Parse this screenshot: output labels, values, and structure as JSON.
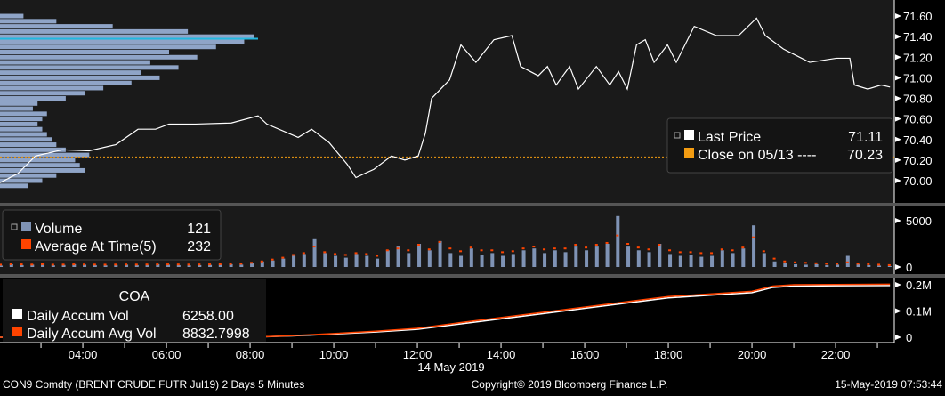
{
  "colors": {
    "price": "#ffffff",
    "close": "#f39c12",
    "volume": "#7f93b5",
    "avg": "#ff4400",
    "accum": "#ffffff",
    "accum_avg": "#ff4400",
    "profile": "#8fa4c7",
    "profile_hi": "#22b8e0"
  },
  "footer": {
    "left": "CON9 Comdty (BRENT CRUDE FUTR  Jul19) 2 Days 5 Minutes",
    "center": "Copyright© 2019 Bloomberg Finance L.P.",
    "right": "15-May-2019 07:53:44"
  },
  "price_legend": {
    "last_label": "Last Price",
    "last_value": "71.11",
    "close_label": "Close on 05/13 ----",
    "close_value": "70.23"
  },
  "volume_legend": {
    "vol_label": "Volume",
    "vol_value": "121",
    "avg_label": "Average At Time(5)",
    "avg_value": "232"
  },
  "accum_legend": {
    "title": "COA",
    "vol_label": "Daily Accum Vol",
    "vol_value": "6258.00",
    "avg_label": "Daily Accum Avg Vol",
    "avg_value": "8832.7998"
  },
  "chart_data": [
    {
      "type": "line",
      "title": "Last Price",
      "ylim": [
        69.87,
        71.75
      ],
      "yticks": [
        "71.60",
        "71.40",
        "71.20",
        "71.00",
        "70.80",
        "70.60",
        "70.40",
        "70.20",
        "70.00"
      ],
      "close_level": 70.23,
      "profile_peak": 71.38,
      "x": [
        2.02,
        2.45,
        2.87,
        3.51,
        4.15,
        4.79,
        5.32,
        5.74,
        6.06,
        6.7,
        7.55,
        8.19,
        8.4,
        9.15,
        9.47,
        9.89,
        10.32,
        10.53,
        10.74,
        10.96,
        11.38,
        11.7,
        12.02,
        12.19,
        12.34,
        12.77,
        13.04,
        13.4,
        13.83,
        14.26,
        14.47,
        14.89,
        15.11,
        15.32,
        15.64,
        15.85,
        16.28,
        16.6,
        16.81,
        17.02,
        17.24,
        17.45,
        17.66,
        17.98,
        18.19,
        18.62,
        19.15,
        19.68,
        20.11,
        20.32,
        20.75,
        21.38,
        22.02,
        22.34,
        22.45,
        22.77,
        23.09,
        23.3
      ],
      "y": [
        69.98,
        70.07,
        70.24,
        70.3,
        70.29,
        70.35,
        70.5,
        70.5,
        70.55,
        70.55,
        70.56,
        70.63,
        70.55,
        70.42,
        70.5,
        70.37,
        70.16,
        70.03,
        70.07,
        70.11,
        70.24,
        70.2,
        70.24,
        70.46,
        70.8,
        70.98,
        71.32,
        71.15,
        71.37,
        71.41,
        71.11,
        71.02,
        71.11,
        70.93,
        71.11,
        70.89,
        71.11,
        70.93,
        71.06,
        70.89,
        71.32,
        71.37,
        71.15,
        71.32,
        71.15,
        71.5,
        71.41,
        71.41,
        71.58,
        71.41,
        71.28,
        71.15,
        71.19,
        71.19,
        70.93,
        70.89,
        70.93,
        70.91
      ],
      "profile_levels": [
        69.95,
        70.0,
        70.05,
        70.1,
        70.15,
        70.2,
        70.25,
        70.3,
        70.35,
        70.4,
        70.45,
        70.5,
        70.55,
        70.6,
        70.65,
        70.7,
        70.75,
        70.8,
        70.85,
        70.9,
        70.95,
        71.0,
        71.05,
        71.1,
        71.15,
        71.2,
        71.25,
        71.3,
        71.35,
        71.4,
        71.45,
        71.5,
        71.55,
        71.6
      ],
      "profile_values": [
        30,
        45,
        60,
        90,
        85,
        80,
        95,
        70,
        60,
        55,
        50,
        45,
        40,
        45,
        50,
        35,
        40,
        70,
        90,
        110,
        140,
        170,
        150,
        190,
        160,
        210,
        180,
        230,
        260,
        270,
        200,
        120,
        60,
        25
      ]
    },
    {
      "type": "bar",
      "title": "Volume",
      "ylim": [
        0,
        6000
      ],
      "yticks": [
        "5000",
        "0"
      ],
      "start": 2.0,
      "step_hours": 0.25,
      "values": [
        150,
        300,
        200,
        250,
        400,
        180,
        220,
        300,
        250,
        200,
        180,
        220,
        250,
        200,
        220,
        300,
        250,
        200,
        180,
        200,
        220,
        250,
        300,
        250,
        400,
        600,
        700,
        900,
        1200,
        1400,
        3000,
        1500,
        1200,
        1000,
        1400,
        1200,
        900,
        1800,
        2200,
        1500,
        2500,
        1800,
        2800,
        1500,
        1200,
        2000,
        1300,
        1500,
        1200,
        1400,
        1800,
        2000,
        1500,
        1800,
        1600,
        2200,
        1800,
        2200,
        2500,
        5500,
        2200,
        1800,
        1600,
        2500,
        1400,
        1200,
        1300,
        1100,
        1200,
        1800,
        1500,
        2000,
        4500,
        1500,
        600,
        400,
        300,
        250,
        300,
        200,
        250,
        1200,
        300,
        200,
        150,
        100
      ],
      "avg": [
        250,
        300,
        280,
        260,
        300,
        250,
        260,
        280,
        270,
        260,
        250,
        260,
        270,
        260,
        270,
        280,
        280,
        270,
        260,
        270,
        280,
        300,
        320,
        350,
        450,
        600,
        800,
        1000,
        1300,
        1500,
        2200,
        1600,
        1400,
        1300,
        1500,
        1400,
        1200,
        1800,
        2000,
        1800,
        2400,
        1900,
        2700,
        2000,
        1700,
        2100,
        1800,
        1800,
        1600,
        1700,
        2000,
        2200,
        1900,
        2000,
        2000,
        2400,
        2100,
        2400,
        2600,
        3400,
        2500,
        2100,
        1900,
        2400,
        1800,
        1600,
        1600,
        1500,
        1500,
        1900,
        1800,
        2100,
        3200,
        1700,
        900,
        600,
        500,
        450,
        400,
        350,
        350,
        500,
        350,
        300,
        250,
        200
      ]
    },
    {
      "type": "line",
      "title": "COA",
      "ylim": [
        0,
        0.22
      ],
      "yticks": [
        "0.2M",
        "0.1M",
        "0"
      ],
      "x": [
        2.0,
        8.0,
        9.0,
        10.0,
        11.0,
        12.0,
        13.0,
        14.0,
        15.0,
        16.0,
        17.0,
        18.0,
        19.0,
        20.0,
        20.5,
        21.0,
        22.0,
        23.3
      ],
      "series": [
        {
          "name": "Daily Accum Vol",
          "y": [
            0,
            0,
            0.005,
            0.012,
            0.02,
            0.03,
            0.05,
            0.07,
            0.09,
            0.11,
            0.13,
            0.15,
            0.16,
            0.17,
            0.19,
            0.195,
            0.196,
            0.197
          ]
        },
        {
          "name": "Daily Accum Avg Vol",
          "y": [
            0,
            0,
            0.006,
            0.014,
            0.023,
            0.034,
            0.055,
            0.075,
            0.095,
            0.115,
            0.135,
            0.155,
            0.165,
            0.175,
            0.195,
            0.2,
            0.201,
            0.202
          ]
        }
      ]
    }
  ],
  "xaxis": {
    "ticks": [
      "04:00",
      "06:00",
      "08:00",
      "10:00",
      "12:00",
      "14:00",
      "16:00",
      "18:00",
      "20:00",
      "22:00"
    ],
    "tick_hours": [
      4,
      6,
      8,
      10,
      12,
      14,
      16,
      18,
      20,
      22
    ],
    "date_label": "14 May 2019"
  }
}
